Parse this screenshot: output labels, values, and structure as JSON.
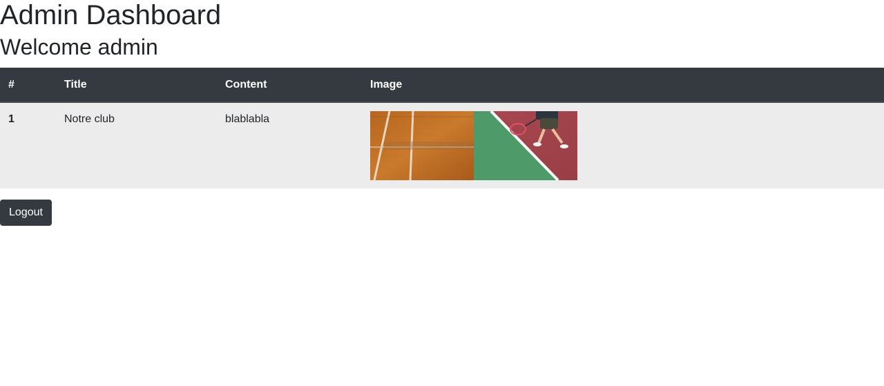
{
  "header": {
    "title": "Admin Dashboard",
    "welcome": "Welcome admin"
  },
  "table": {
    "columns": [
      "#",
      "Title",
      "Content",
      "Image"
    ],
    "rows": [
      {
        "num": "1",
        "title": "Notre club",
        "content": "blablabla",
        "image": "tennis-court-photo"
      }
    ]
  },
  "actions": {
    "logout_label": "Logout"
  },
  "colors": {
    "header_bg": "#343a40",
    "row_bg": "#ececec",
    "button_bg": "#343a40"
  }
}
